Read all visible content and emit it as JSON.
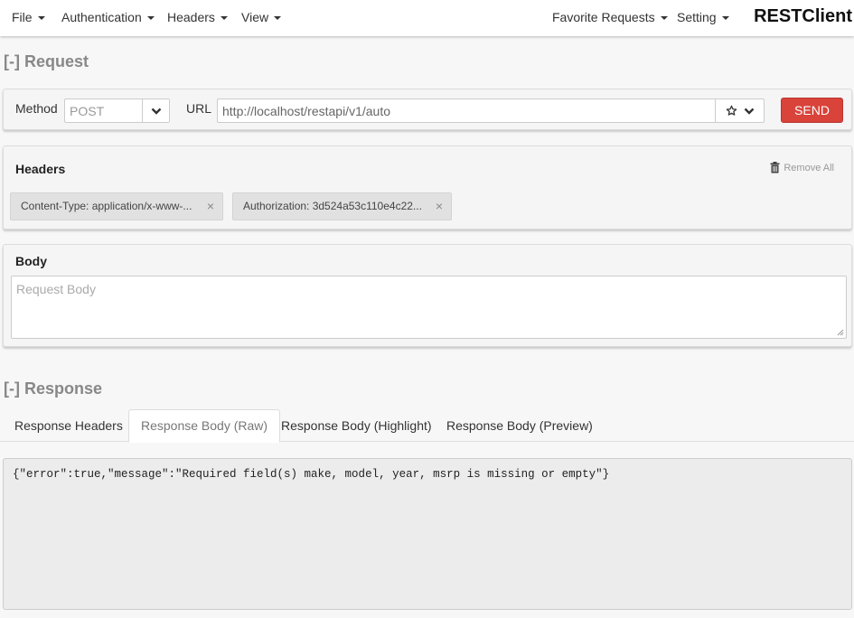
{
  "navbar": {
    "menus": [
      {
        "label": "File"
      },
      {
        "label": "Authentication"
      },
      {
        "label": "Headers"
      },
      {
        "label": "View"
      }
    ],
    "right_menus": [
      {
        "label": "Favorite Requests"
      },
      {
        "label": "Setting"
      }
    ],
    "brand": "RESTClient"
  },
  "request": {
    "section_title": "[-] Request",
    "method_label": "Method",
    "method_value": "POST",
    "url_label": "URL",
    "url_value": "http://localhost/restapi/v1/auto",
    "send_label": "SEND"
  },
  "headers_panel": {
    "title": "Headers",
    "remove_all_label": "Remove All",
    "chips": [
      {
        "text": "Content-Type: application/x-www-..."
      },
      {
        "text": "Authorization: 3d524a53c110e4c22..."
      }
    ]
  },
  "body_panel": {
    "title": "Body",
    "placeholder": "Request Body"
  },
  "response": {
    "section_title": "[-] Response",
    "tabs": [
      {
        "label": "Response Headers"
      },
      {
        "label": "Response Body (Raw)"
      },
      {
        "label": "Response Body (Highlight)"
      },
      {
        "label": "Response Body (Preview)"
      }
    ],
    "active_tab": "Response Body (Raw)",
    "raw_body": "{\"error\":true,\"message\":\"Required field(s) make, model, year, msrp is missing or empty\"}"
  },
  "colors": {
    "send_button": "#d9433a",
    "section_title": "#888888",
    "background": "#f7f7f7"
  }
}
